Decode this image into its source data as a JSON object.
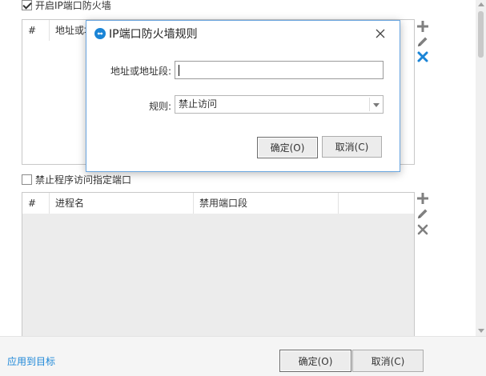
{
  "firewall": {
    "enable_label": "开启IP端口防火墙",
    "enabled": true,
    "columns": [
      "#",
      "地址或地址段"
    ]
  },
  "program": {
    "enable_label": "禁止程序访问指定端口",
    "enabled": false,
    "columns": [
      "#",
      "进程名",
      "禁用端口段"
    ]
  },
  "tools": {
    "add_icon": "plus-icon",
    "edit_icon": "pencil-icon",
    "delete_icon": "cross-icon"
  },
  "dialog": {
    "title": "IP端口防火墙规则",
    "address_label": "地址或地址段:",
    "address_value": "",
    "rule_label": "规则:",
    "rule_value": "禁止访问",
    "ok": "确定(O)",
    "cancel": "取消(C)"
  },
  "footer": {
    "apply_link": "应用到目标",
    "ok": "确定(O)",
    "cancel": "取消(C)"
  },
  "colors": {
    "accent_blue": "#1e88d8",
    "delete_blue": "#1a84d6"
  }
}
